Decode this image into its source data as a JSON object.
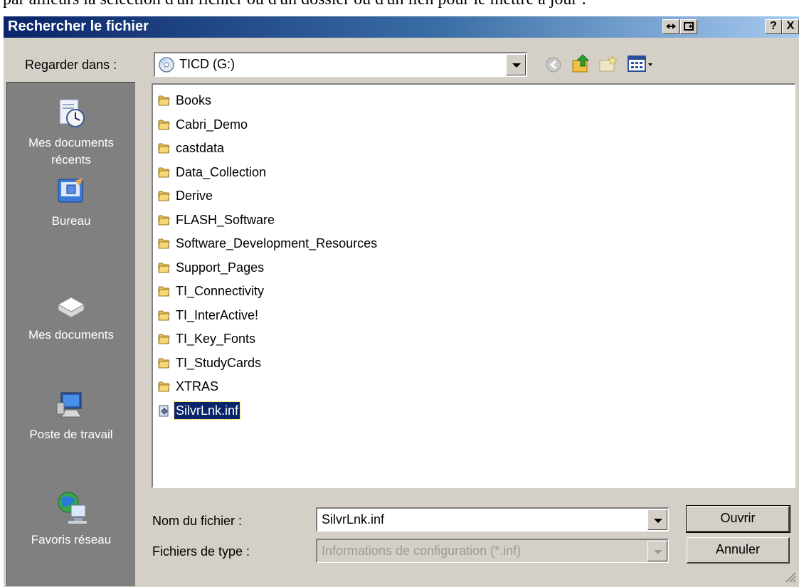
{
  "page_top_text": "par ailleurs la sélection d'un fichier ou d'un dossier ou d'un lien pour le mettre à jour :",
  "dialog": {
    "title": "Rechercher le fichier",
    "help_label": "?",
    "close_label": "X"
  },
  "look_in": {
    "label": "Regarder dans :",
    "value": "TICD (G:)"
  },
  "places": [
    {
      "label_line1": "Mes documents",
      "label_line2": "récents",
      "icon": "recent-documents-icon"
    },
    {
      "label_line1": "Bureau",
      "label_line2": "",
      "icon": "desktop-icon"
    },
    {
      "label_line1": "Mes documents",
      "label_line2": "",
      "icon": "my-documents-icon"
    },
    {
      "label_line1": "Poste de travail",
      "label_line2": "",
      "icon": "my-computer-icon"
    },
    {
      "label_line1": "Favoris réseau",
      "label_line2": "",
      "icon": "network-places-icon"
    }
  ],
  "files": [
    {
      "name": "Books",
      "type": "folder"
    },
    {
      "name": "Cabri_Demo",
      "type": "folder"
    },
    {
      "name": "castdata",
      "type": "folder"
    },
    {
      "name": "Data_Collection",
      "type": "folder"
    },
    {
      "name": "Derive",
      "type": "folder"
    },
    {
      "name": "FLASH_Software",
      "type": "folder"
    },
    {
      "name": "Software_Development_Resources",
      "type": "folder"
    },
    {
      "name": "Support_Pages",
      "type": "folder"
    },
    {
      "name": "TI_Connectivity",
      "type": "folder"
    },
    {
      "name": "TI_InterActive!",
      "type": "folder"
    },
    {
      "name": "TI_Key_Fonts",
      "type": "folder"
    },
    {
      "name": "TI_StudyCards",
      "type": "folder"
    },
    {
      "name": "XTRAS",
      "type": "folder"
    },
    {
      "name": "SilvrLnk.inf",
      "type": "file",
      "selected": true
    }
  ],
  "filename": {
    "label": "Nom du fichier :",
    "value": "SilvrLnk.inf"
  },
  "filetype": {
    "label": "Fichiers de type :",
    "value": "Informations de configuration (*.inf)"
  },
  "buttons": {
    "open": "Ouvrir",
    "cancel": "Annuler"
  },
  "colors": {
    "dialog_bg": "#d4d0c8",
    "title_start": "#0a246a",
    "title_end": "#a6caf0",
    "selection": "#0a246a",
    "places_bg": "#808080"
  }
}
